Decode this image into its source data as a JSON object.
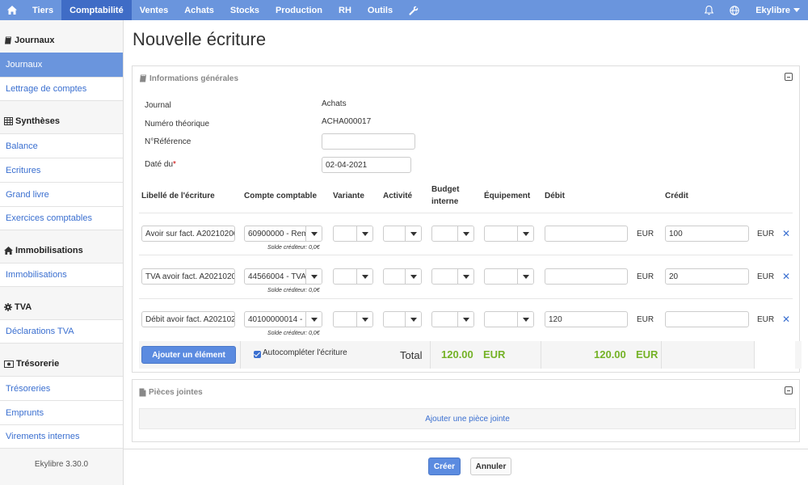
{
  "topnav": {
    "items": [
      "Tiers",
      "Comptabilité",
      "Ventes",
      "Achats",
      "Stocks",
      "Production",
      "RH",
      "Outils"
    ],
    "active": "Comptabilité",
    "user_menu": "Ekylibre"
  },
  "sidebar": {
    "sections": [
      {
        "title": "Journaux",
        "icon": "book-icon",
        "items": [
          "Journaux",
          "Lettrage de comptes"
        ]
      },
      {
        "title": "Synthèses",
        "icon": "table-icon",
        "items": [
          "Balance",
          "Ecritures",
          "Grand livre",
          "Exercices comptables"
        ]
      },
      {
        "title": "Immobilisations",
        "icon": "home-icon",
        "items": [
          "Immobilisations"
        ]
      },
      {
        "title": "TVA",
        "icon": "gear-icon",
        "items": [
          "Déclarations TVA"
        ]
      },
      {
        "title": "Trésorerie",
        "icon": "money-icon",
        "items": [
          "Trésoreries",
          "Emprunts",
          "Virements internes"
        ]
      }
    ],
    "active_item": "Journaux",
    "version": "Ekylibre 3.30.0"
  },
  "page": {
    "title": "Nouvelle écriture"
  },
  "general": {
    "header": "Informations générales",
    "journal_label": "Journal",
    "journal_value": "Achats",
    "number_label": "Numéro théorique",
    "number_value": "ACHA000017",
    "reference_label": "N°Référence",
    "reference_value": "",
    "date_label": "Daté du",
    "date_required": "*",
    "date_value": "02-04-2021"
  },
  "table": {
    "headers": {
      "label": "Libellé de l'écriture",
      "account": "Compte comptable",
      "variant": "Variante",
      "activity": "Activité",
      "budget_line1": "Budget",
      "budget_line2": "interne",
      "equipment": "Équipement",
      "debit": "Débit",
      "credit": "Crédit"
    },
    "rows": [
      {
        "label": "Avoir sur fact. A20210200",
        "account": "60900000 - Rem",
        "hint": "Solde créditeur: 0,0€",
        "debit": "",
        "credit": "100",
        "currency": "EUR"
      },
      {
        "label": "TVA avoir fact. A2021020",
        "account": "44566004 - TVA",
        "hint": "Solde créditeur: 0,0€",
        "debit": "",
        "credit": "20",
        "currency": "EUR"
      },
      {
        "label": "Débit avoir fact. A202102",
        "account": "40100000014 - I",
        "hint": "Solde créditeur: 0,0€",
        "debit": "120",
        "credit": "",
        "currency": "EUR"
      }
    ],
    "add_button": "Ajouter un élément",
    "autocomplete_label": "Autocompléter l'écriture",
    "total_label": "Total",
    "total_debit": "120.00",
    "total_credit": "120.00",
    "total_currency": "EUR"
  },
  "attachments": {
    "header": "Pièces jointes",
    "add_link": "Ajouter une pièce jointe"
  },
  "actions": {
    "create": "Créer",
    "cancel": "Annuler"
  },
  "colors": {
    "nav": "#6a95dd",
    "nav_active": "#3f6cc6",
    "link": "#3a6fd0",
    "total_green": "#74b226"
  }
}
